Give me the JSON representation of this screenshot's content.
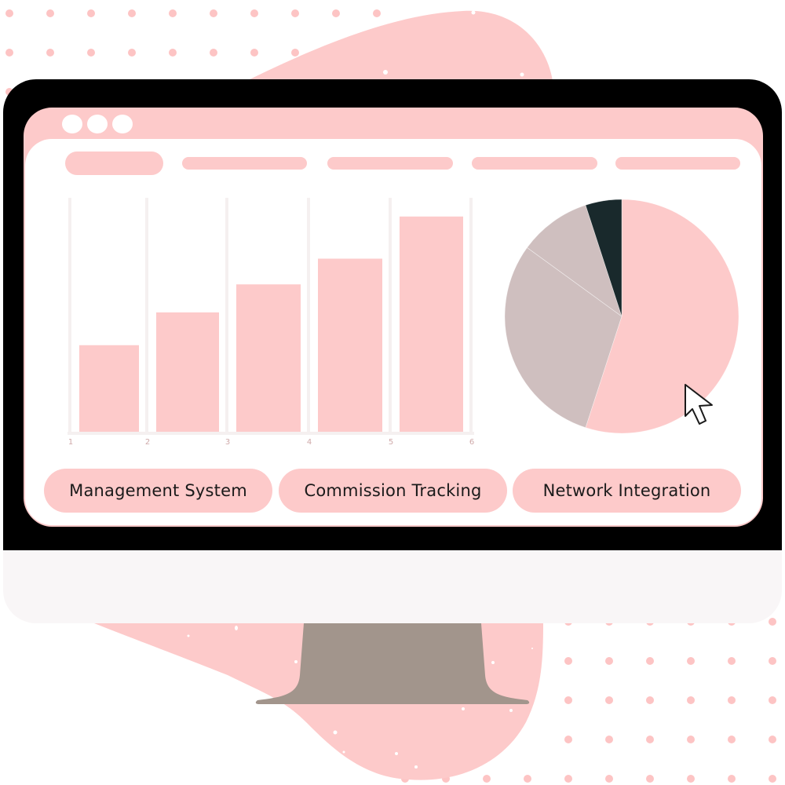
{
  "colors": {
    "accent_pink": "#fdcaca",
    "frame_black": "#000000",
    "chin": "#f9f6f7",
    "stand": "#a2958c",
    "pie_mauve": "#cfbfbf",
    "pie_dark": "#19292c",
    "gridline": "#f5f0f0",
    "dot_pattern": "#fdc4c4"
  },
  "browser": {
    "window_controls": [
      "dot",
      "dot",
      "dot"
    ],
    "nav_items": [
      "",
      "",
      "",
      "",
      ""
    ]
  },
  "buttons": [
    {
      "label": "Management System"
    },
    {
      "label": "Commission Tracking"
    },
    {
      "label": "Network Integration"
    }
  ],
  "cursor": {
    "icon": "arrow-pointer-icon"
  },
  "chart_data": [
    {
      "type": "bar",
      "title": "",
      "xlabel": "",
      "ylabel": "",
      "x_tick_labels": [
        "1",
        "2",
        "3",
        "4",
        "5",
        "6"
      ],
      "categories": [
        "1",
        "2",
        "3",
        "4",
        "5"
      ],
      "values": [
        37,
        51,
        63,
        74,
        92
      ],
      "ylim": [
        0,
        100
      ],
      "grid": "vertical",
      "color": "#fdcaca"
    },
    {
      "type": "pie",
      "title": "",
      "start": "top",
      "direction": "clockwise",
      "slices": [
        {
          "label": "",
          "value": 55,
          "color": "#fdcaca"
        },
        {
          "label": "",
          "value": 30,
          "color": "#cfbfbf"
        },
        {
          "label": "",
          "value": 10,
          "color": "#cfbfbf"
        },
        {
          "label": "",
          "value": 5,
          "color": "#19292c"
        }
      ]
    }
  ]
}
